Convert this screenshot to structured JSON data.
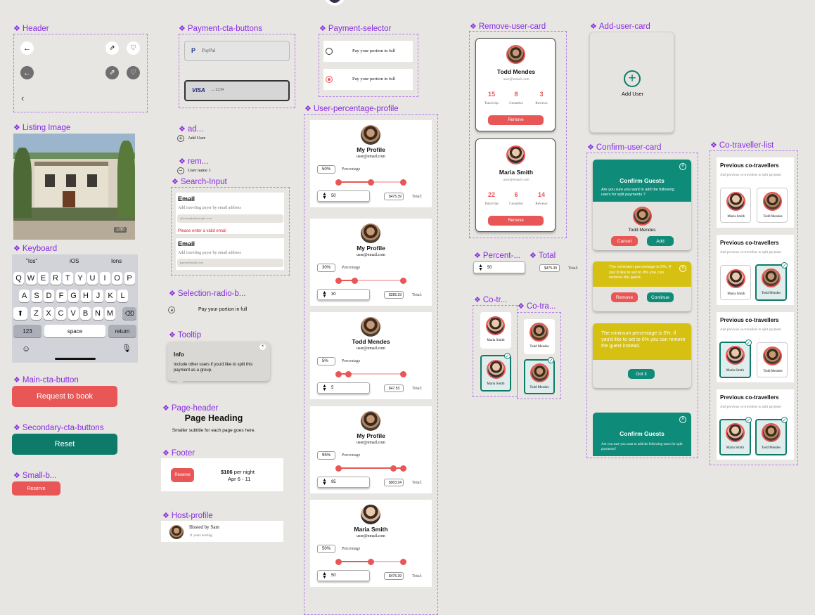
{
  "labels": {
    "header": "Header",
    "listing_image": "Listing Image",
    "keyboard": "Keyboard",
    "main_cta": "Main-cta-button",
    "secondary_cta": "Secondary-cta-buttons",
    "small_b": "Small-b...",
    "payment_cta": "Payment-cta-buttons",
    "ad": "ad...",
    "rem": "rem...",
    "search_input": "Search-Input",
    "selection_radio": "Selection-radio-b...",
    "tooltip": "Tooltip",
    "page_header": "Page-header",
    "footer": "Footer",
    "host_profile": "Host-profile",
    "payment_selector": "Payment-selector",
    "user_percentage_profile": "User-percentage-profile",
    "remove_user_card": "Remove-user-card",
    "percent": "Percent-...",
    "total": "Total",
    "co_tr": "Co-tr...",
    "co_tra": "Co-tra...",
    "add_user_card": "Add-user-card",
    "confirm_user_card": "Confirm-user-card",
    "co_traveller_list": "Co-traveller-list"
  },
  "keyboard": {
    "suggestions": [
      "\"Ios\"",
      "iOS",
      "Ions"
    ],
    "row1": [
      "Q",
      "W",
      "E",
      "R",
      "T",
      "Y",
      "U",
      "I",
      "O",
      "P"
    ],
    "row2": [
      "A",
      "S",
      "D",
      "F",
      "G",
      "H",
      "J",
      "K",
      "L"
    ],
    "row3": [
      "Z",
      "X",
      "C",
      "V",
      "B",
      "N",
      "M"
    ],
    "num_label": "123",
    "space_label": "space",
    "return_label": "return"
  },
  "buttons": {
    "request_to_book": "Request to book",
    "reset": "Reset",
    "reserve_small": "Reserve",
    "reserve_footer": "Reserve"
  },
  "payment": {
    "paypal_label": "PayPal",
    "visa_label": "VISA",
    "card_number": "....1234"
  },
  "add_user_small": "Add User",
  "remove_user_small": "User name 1",
  "search": {
    "email_label": "Email",
    "help": "Add traveling payer by email address",
    "placeholder": "@example@sample.com",
    "error": "Please enter a valid email",
    "email_label2": "Email",
    "help2": "Add traveling payer by email address",
    "placeholder2": "payer@email.com"
  },
  "radio_text": "Pay your portion in full",
  "tooltip": {
    "title": "Info",
    "body": "Include other users if you'd like to split this payment as a group."
  },
  "page_header": {
    "heading": "Page Heading",
    "subtitle": "Smaller subtitle for each page goes here."
  },
  "footer": {
    "price": "$106",
    "per_night": " per night",
    "dates": "Apr 6 - 11"
  },
  "host": {
    "name": "Hosted by Sam",
    "years": "11 years hosting"
  },
  "payment_selector": {
    "option1": "Pay your portion in full",
    "option2": "Pay your portion in full"
  },
  "profiles": [
    {
      "name": "My Profile",
      "email": "user@email.com",
      "percent": "50%",
      "fraction": 0.5,
      "qty": "50",
      "amount": "$475.39",
      "total_label": "Total:"
    },
    {
      "name": "My Profile",
      "email": "user@email.com",
      "percent": "30%",
      "fraction": 0.3,
      "qty": "30",
      "amount": "$285.23",
      "total_label": "Total:"
    },
    {
      "name": "Todd Mendes",
      "email": "user@email.com",
      "percent": "5%",
      "fraction": 0.05,
      "qty": "5",
      "amount": "$47.53",
      "total_label": "Total:"
    },
    {
      "name": "My Profile",
      "email": "user@email.com",
      "percent": "95%",
      "fraction": 0.95,
      "qty": "95",
      "amount": "$903.24",
      "total_label": "Total:"
    },
    {
      "name": "Maria Smith",
      "email": "user@email.com",
      "percent": "50%",
      "fraction": 0.5,
      "qty": "50",
      "amount": "$475.39",
      "total_label": "Total:"
    }
  ],
  "percentage_label": "Percentage",
  "remove_cards": [
    {
      "name": "Todd Mendes",
      "email": "user@email.com",
      "trips": "15",
      "countries": "8",
      "reviews": "3",
      "btn": "Remove"
    },
    {
      "name": "Maria Smith",
      "email": "user@email.com",
      "trips": "22",
      "countries": "6",
      "reviews": "14",
      "btn": "Remove"
    }
  ],
  "stat_labels": {
    "trips": "Total trips",
    "countries": "Countries",
    "reviews": "Reviews"
  },
  "percent_widget": {
    "qty": "50",
    "amount": "$475.39",
    "total_label": "Total:"
  },
  "co_small": {
    "maria": "Maria Smith",
    "todd": "Todd Mendes"
  },
  "add_user_card": "Add User",
  "confirm": {
    "title": "Confirm Guests",
    "body": "Are you sure you want to add the following users for split payments ?",
    "user": "Todd Mendes",
    "cancel": "Cancel",
    "add": "Add",
    "warning1": "The minimum percentage is 5%. If you'd like to set to 0% you can remove the guest.",
    "remove": "Remove",
    "continue": "Continue",
    "warning2": "The minimum percentage is 5%. If you'd like to set to 0% you can remove the guest instead.",
    "got_it": "Got it",
    "title2": "Confirm Guests",
    "body2": "Are you sure you want to add the following users for split payments?"
  },
  "co_list": {
    "title": "Previous co-travellers",
    "sub": "Add previous co-travellers to split payment",
    "maria": "Maria Smith",
    "todd": "Todd Mendes"
  },
  "colors": {
    "accent_red": "#e85656",
    "teal": "#0e7a6a",
    "label_purple": "#8a2be2",
    "warning_yellow": "#d6c012"
  }
}
